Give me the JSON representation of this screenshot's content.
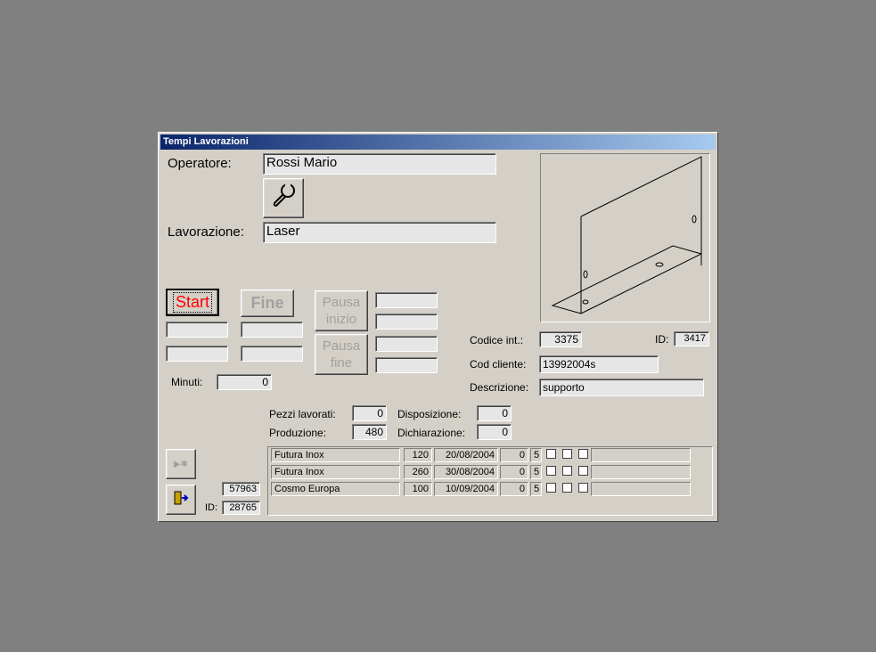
{
  "window": {
    "title": "Tempi Lavorazioni"
  },
  "operatore": {
    "label": "Operatore:",
    "value": "Rossi Mario"
  },
  "tool_button": {
    "icon": "wrench-icon"
  },
  "lavorazione": {
    "label": "Lavorazione:",
    "value": "Laser"
  },
  "buttons": {
    "start": "Start",
    "fine": "Fine",
    "pausa_inizio": "Pausa inizio",
    "pausa_fine": "Pausa fine"
  },
  "minuti": {
    "label": "Minuti:",
    "value": "0"
  },
  "codice_int": {
    "label": "Codice  int.:",
    "value": "3375"
  },
  "part_id": {
    "label": "ID:",
    "value": "3417"
  },
  "cod_cliente": {
    "label": "Cod cliente:",
    "value": "13992004s"
  },
  "descrizione": {
    "label": "Descrizione:",
    "value": "supporto"
  },
  "pezzi_lavorati": {
    "label": "Pezzi lavorati:",
    "value": "0"
  },
  "produzione": {
    "label": "Produzione:",
    "value": "480"
  },
  "disposizione": {
    "label": "Disposizione:",
    "value": "0"
  },
  "dichiarazione": {
    "label": "Dichiarazione:",
    "value": "0"
  },
  "record": {
    "number": "57963",
    "id_label": "ID:",
    "id": "28765"
  },
  "orders": [
    {
      "cliente": "Futura Inox",
      "qty": "120",
      "date": "20/08/2004",
      "n1": "0",
      "n2": "5"
    },
    {
      "cliente": "Futura Inox",
      "qty": "260",
      "date": "30/08/2004",
      "n1": "0",
      "n2": "5"
    },
    {
      "cliente": "Cosmo Europa",
      "qty": "100",
      "date": "10/09/2004",
      "n1": "0",
      "n2": "5"
    }
  ],
  "colors": {
    "title_start": "#0a246a",
    "title_end": "#a6caf0",
    "start_text": "#ff0000",
    "face": "#d4d0c8"
  }
}
